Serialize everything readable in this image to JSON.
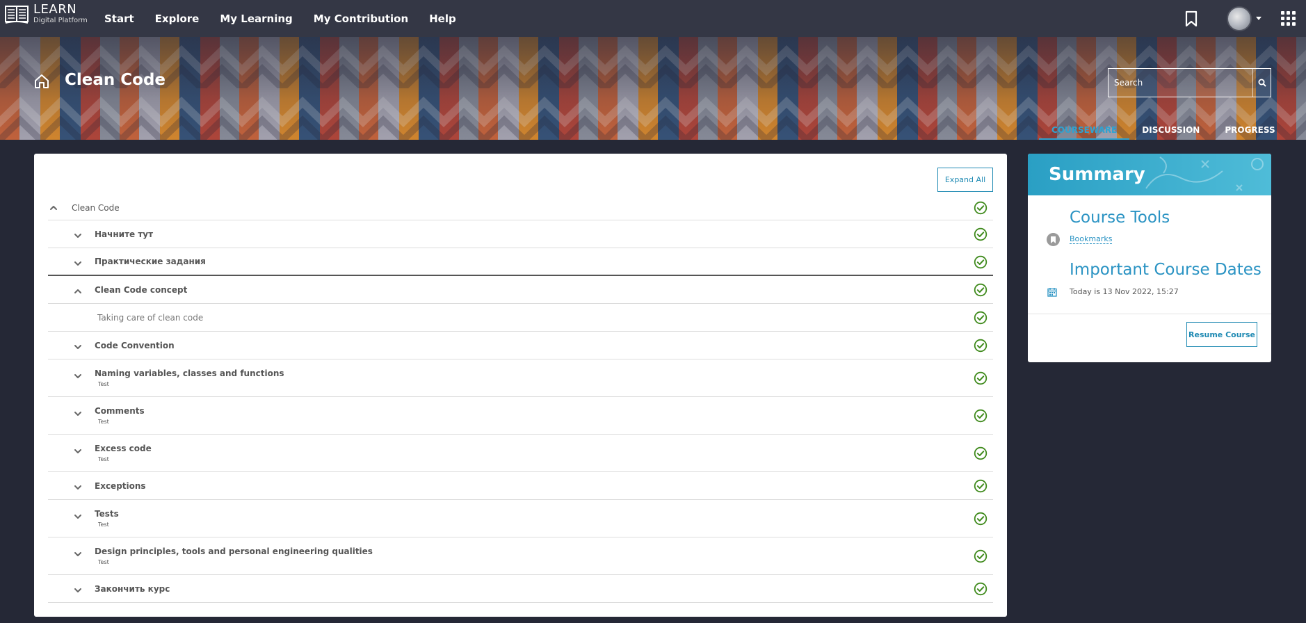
{
  "brand": {
    "title": "LEARN",
    "subtitle": "Digital Platform"
  },
  "nav": {
    "items": [
      "Start",
      "Explore",
      "My Learning",
      "My Contribution",
      "Help"
    ]
  },
  "course": {
    "title": "Clean Code"
  },
  "search": {
    "placeholder": "Search"
  },
  "tabs": [
    {
      "label": "COURSEWARE",
      "active": true
    },
    {
      "label": "DISCUSSION",
      "active": false
    },
    {
      "label": "PROGRESS",
      "active": false
    }
  ],
  "outline": {
    "expand_all_label": "Expand All",
    "root": {
      "title": "Clean Code",
      "expanded": true,
      "complete": true
    },
    "sections": [
      {
        "title": "Начните тут",
        "subtitle": "",
        "expanded": false,
        "complete": true
      },
      {
        "title": "Практические задания",
        "subtitle": "",
        "expanded": false,
        "complete": true
      },
      {
        "title": "Clean Code concept",
        "subtitle": "",
        "expanded": true,
        "complete": true
      },
      {
        "title": "Taking care of clean code",
        "subtitle": "",
        "unit": true,
        "complete": true
      },
      {
        "title": "Code Convention",
        "subtitle": "",
        "expanded": false,
        "complete": true
      },
      {
        "title": "Naming variables, classes and functions",
        "subtitle": "Test",
        "expanded": false,
        "complete": true
      },
      {
        "title": "Comments",
        "subtitle": "Test",
        "expanded": false,
        "complete": true
      },
      {
        "title": "Excess code",
        "subtitle": "Test",
        "expanded": false,
        "complete": true
      },
      {
        "title": "Exceptions",
        "subtitle": "",
        "expanded": false,
        "complete": true
      },
      {
        "title": "Tests",
        "subtitle": "Test",
        "expanded": false,
        "complete": true
      },
      {
        "title": "Design principles, tools and personal engineering qualities",
        "subtitle": "Test",
        "expanded": false,
        "complete": true
      },
      {
        "title": "Закончить курс",
        "subtitle": "",
        "expanded": false,
        "complete": true
      }
    ]
  },
  "summary": {
    "title": "Summary",
    "course_tools_heading": "Course Tools",
    "bookmarks_label": "Bookmarks",
    "dates_heading": "Important Course Dates",
    "today_text": "Today is 13 Nov 2022, 15:27",
    "resume_label": "Resume Course"
  },
  "colors": {
    "accent": "#2a93c3",
    "check": "#3f8a1c",
    "nav_bg": "#343745",
    "page_bg": "#252836"
  },
  "icons": {
    "logo": "open-book-icon",
    "home": "home-icon",
    "search": "search-icon",
    "bookmark": "bookmark-icon",
    "apps": "apps-grid-icon",
    "complete": "check-circle-icon",
    "calendar": "calendar-icon"
  }
}
